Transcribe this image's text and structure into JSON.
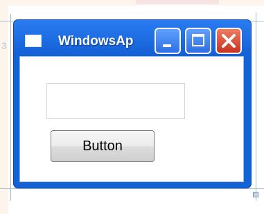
{
  "window": {
    "title": "WindowsAp",
    "controls": {
      "minimize_icon": "minimize-icon",
      "maximize_icon": "maximize-icon",
      "close_icon": "close-icon"
    }
  },
  "form": {
    "textbox_value": "",
    "button_label": "Button"
  },
  "colors": {
    "titlebar": "#1460d6",
    "close_button": "#c8321f",
    "control_button": "#2d6fe6",
    "client_background": "#ffffff"
  }
}
